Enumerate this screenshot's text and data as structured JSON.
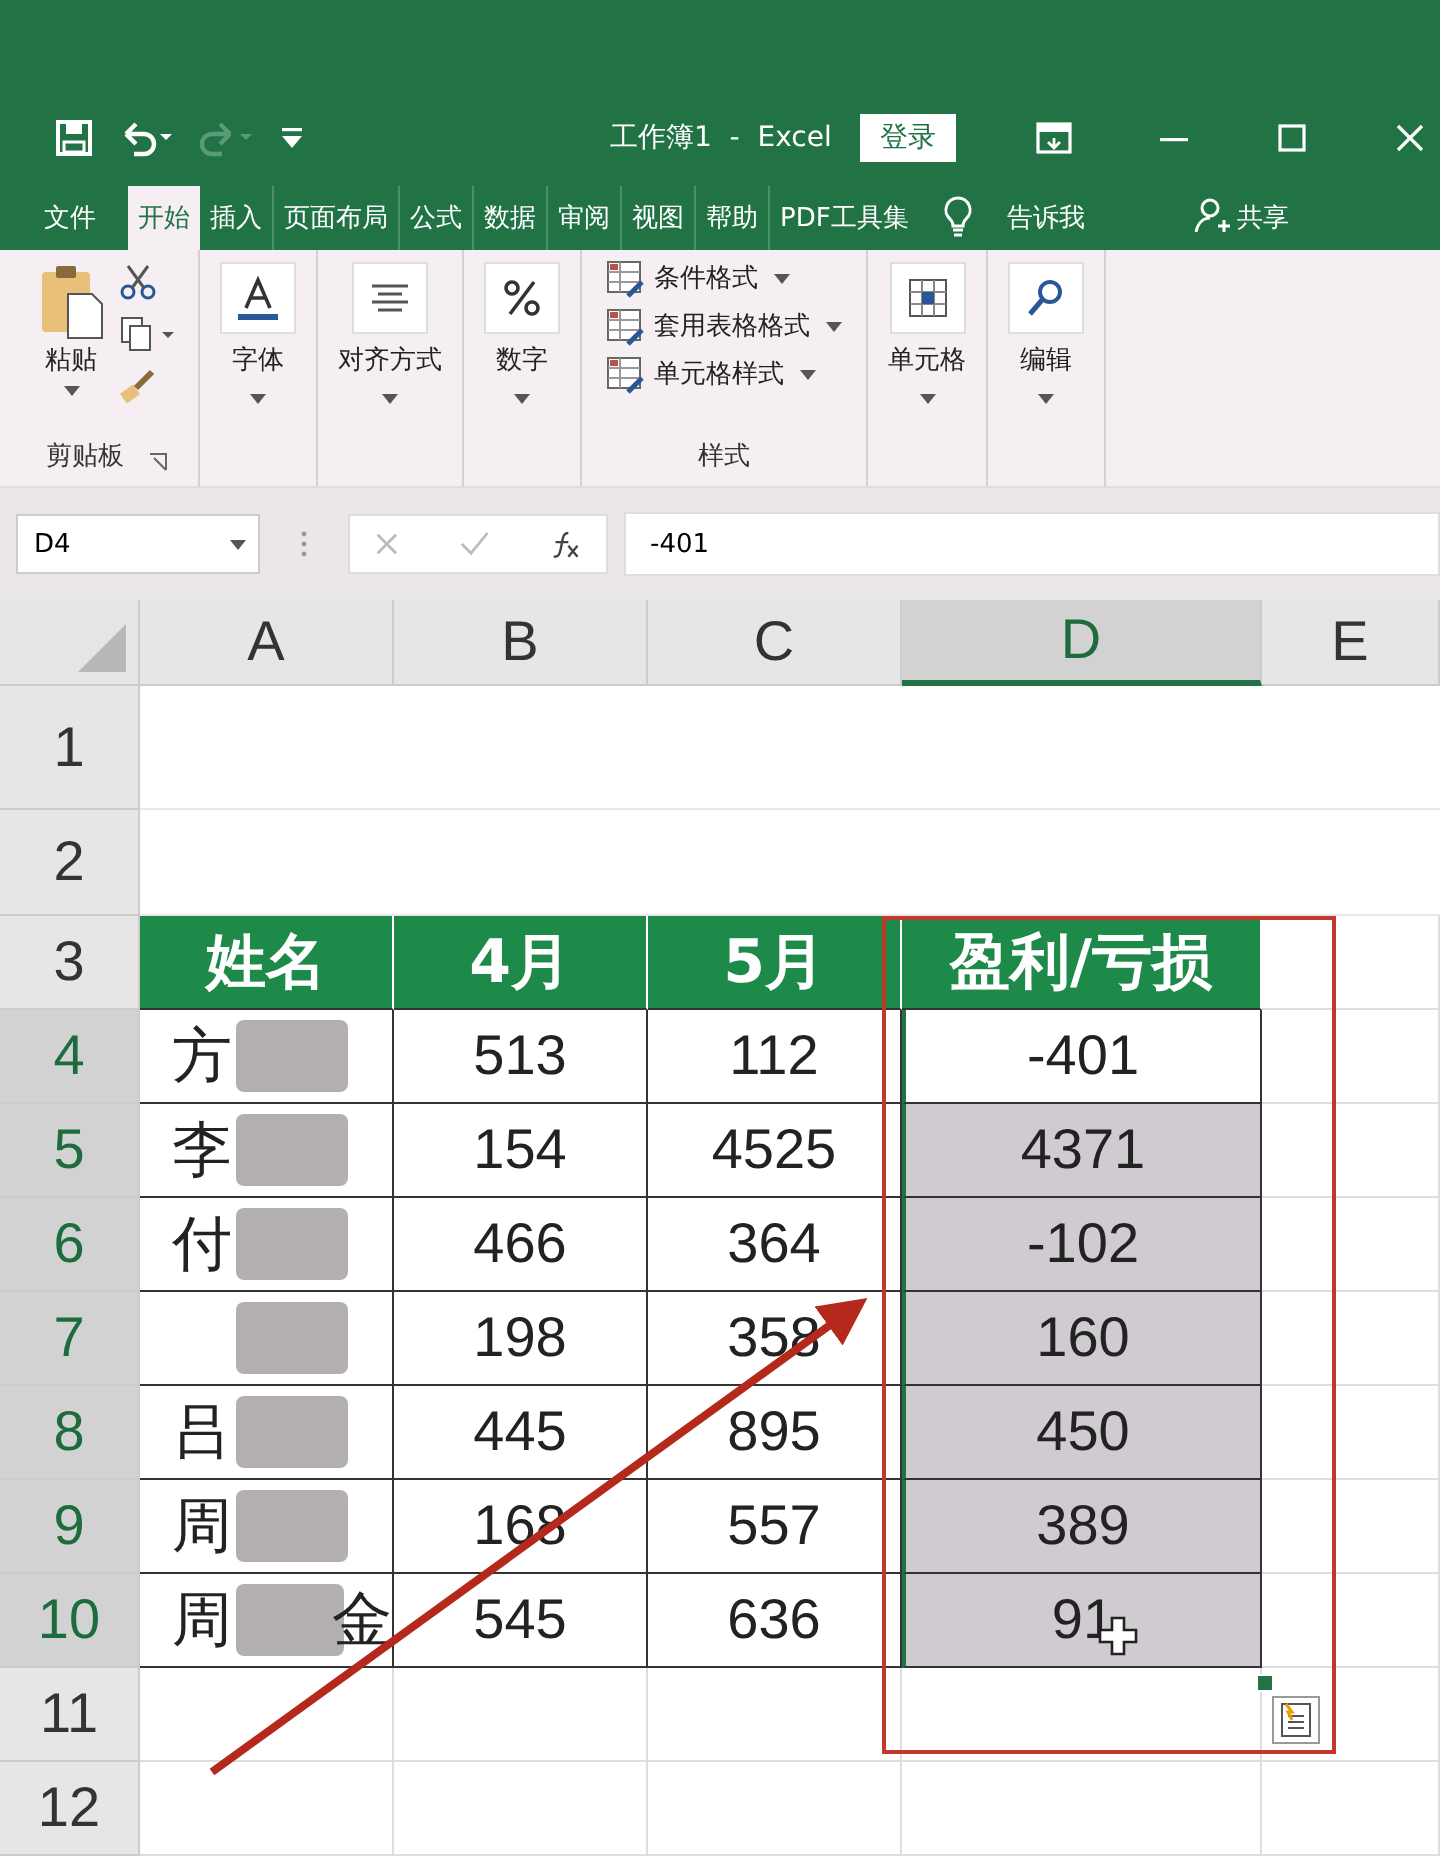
{
  "window": {
    "title": "工作簿1  -  Excel",
    "login": "登录"
  },
  "tabs": [
    {
      "label": "文件",
      "selected": false
    },
    {
      "label": "开始",
      "selected": true
    },
    {
      "label": "插入",
      "selected": false
    },
    {
      "label": "页面布局",
      "selected": false
    },
    {
      "label": "公式",
      "selected": false
    },
    {
      "label": "数据",
      "selected": false
    },
    {
      "label": "审阅",
      "selected": false
    },
    {
      "label": "视图",
      "selected": false
    },
    {
      "label": "帮助",
      "selected": false
    },
    {
      "label": "PDF工具集",
      "selected": false
    }
  ],
  "tell_me": "告诉我",
  "share": "共享",
  "ribbon": {
    "clipboard": {
      "paste": "粘贴",
      "label": "剪贴板"
    },
    "big_groups": [
      {
        "kind": "font",
        "label": "字体"
      },
      {
        "kind": "align",
        "label": "对齐方式"
      },
      {
        "kind": "number",
        "label": "数字"
      }
    ],
    "styles": {
      "items": [
        "条件格式",
        "套用表格格式",
        "单元格样式"
      ],
      "label": "样式"
    },
    "tail_groups": [
      {
        "kind": "cells",
        "label": "单元格"
      },
      {
        "kind": "edit",
        "label": "编辑"
      }
    ]
  },
  "formula_bar": {
    "name_box": "D4",
    "formula": "-401"
  },
  "columns": [
    {
      "label": "A",
      "selected": false
    },
    {
      "label": "B",
      "selected": false
    },
    {
      "label": "C",
      "selected": false
    },
    {
      "label": "D",
      "selected": true
    },
    {
      "label": "E",
      "selected": false
    }
  ],
  "header_row": {
    "number": "3",
    "selected": false,
    "cells": [
      "姓名",
      "4月",
      "5月",
      "盈利/亏损"
    ]
  },
  "data_rows": [
    {
      "number": "4",
      "selected": true,
      "name": {
        "text": "方"
      },
      "values": [
        "513",
        "112"
      ],
      "profit": {
        "text": "-401",
        "active": true
      }
    },
    {
      "number": "5",
      "selected": true,
      "name": {
        "text": "李"
      },
      "values": [
        "154",
        "4525"
      ],
      "profit": {
        "text": "4371",
        "active": false
      }
    },
    {
      "number": "6",
      "selected": true,
      "name": {
        "text": "付"
      },
      "values": [
        "466",
        "364"
      ],
      "profit": {
        "text": "-102",
        "active": false
      }
    },
    {
      "number": "7",
      "selected": true,
      "name": {},
      "values": [
        "198",
        "358"
      ],
      "profit": {
        "text": "160",
        "active": false
      }
    },
    {
      "number": "8",
      "selected": true,
      "name": {
        "text": "吕"
      },
      "values": [
        "445",
        "895"
      ],
      "profit": {
        "text": "450",
        "active": false
      }
    },
    {
      "number": "9",
      "selected": true,
      "name": {
        "text": "周"
      },
      "values": [
        "168",
        "557"
      ],
      "profit": {
        "text": "389",
        "active": false
      }
    },
    {
      "number": "10",
      "selected": true,
      "name": {
        "text": "周",
        "tail": "金"
      },
      "values": [
        "545",
        "636"
      ],
      "profit": {
        "text": "91",
        "active": false
      }
    }
  ],
  "blank_rows_top": [
    {
      "number": "1",
      "selected": false
    },
    {
      "number": "2",
      "selected": false
    }
  ],
  "blank_rows_bottom": [
    {
      "number": "11",
      "selected": false
    },
    {
      "number": "12",
      "selected": false
    }
  ]
}
